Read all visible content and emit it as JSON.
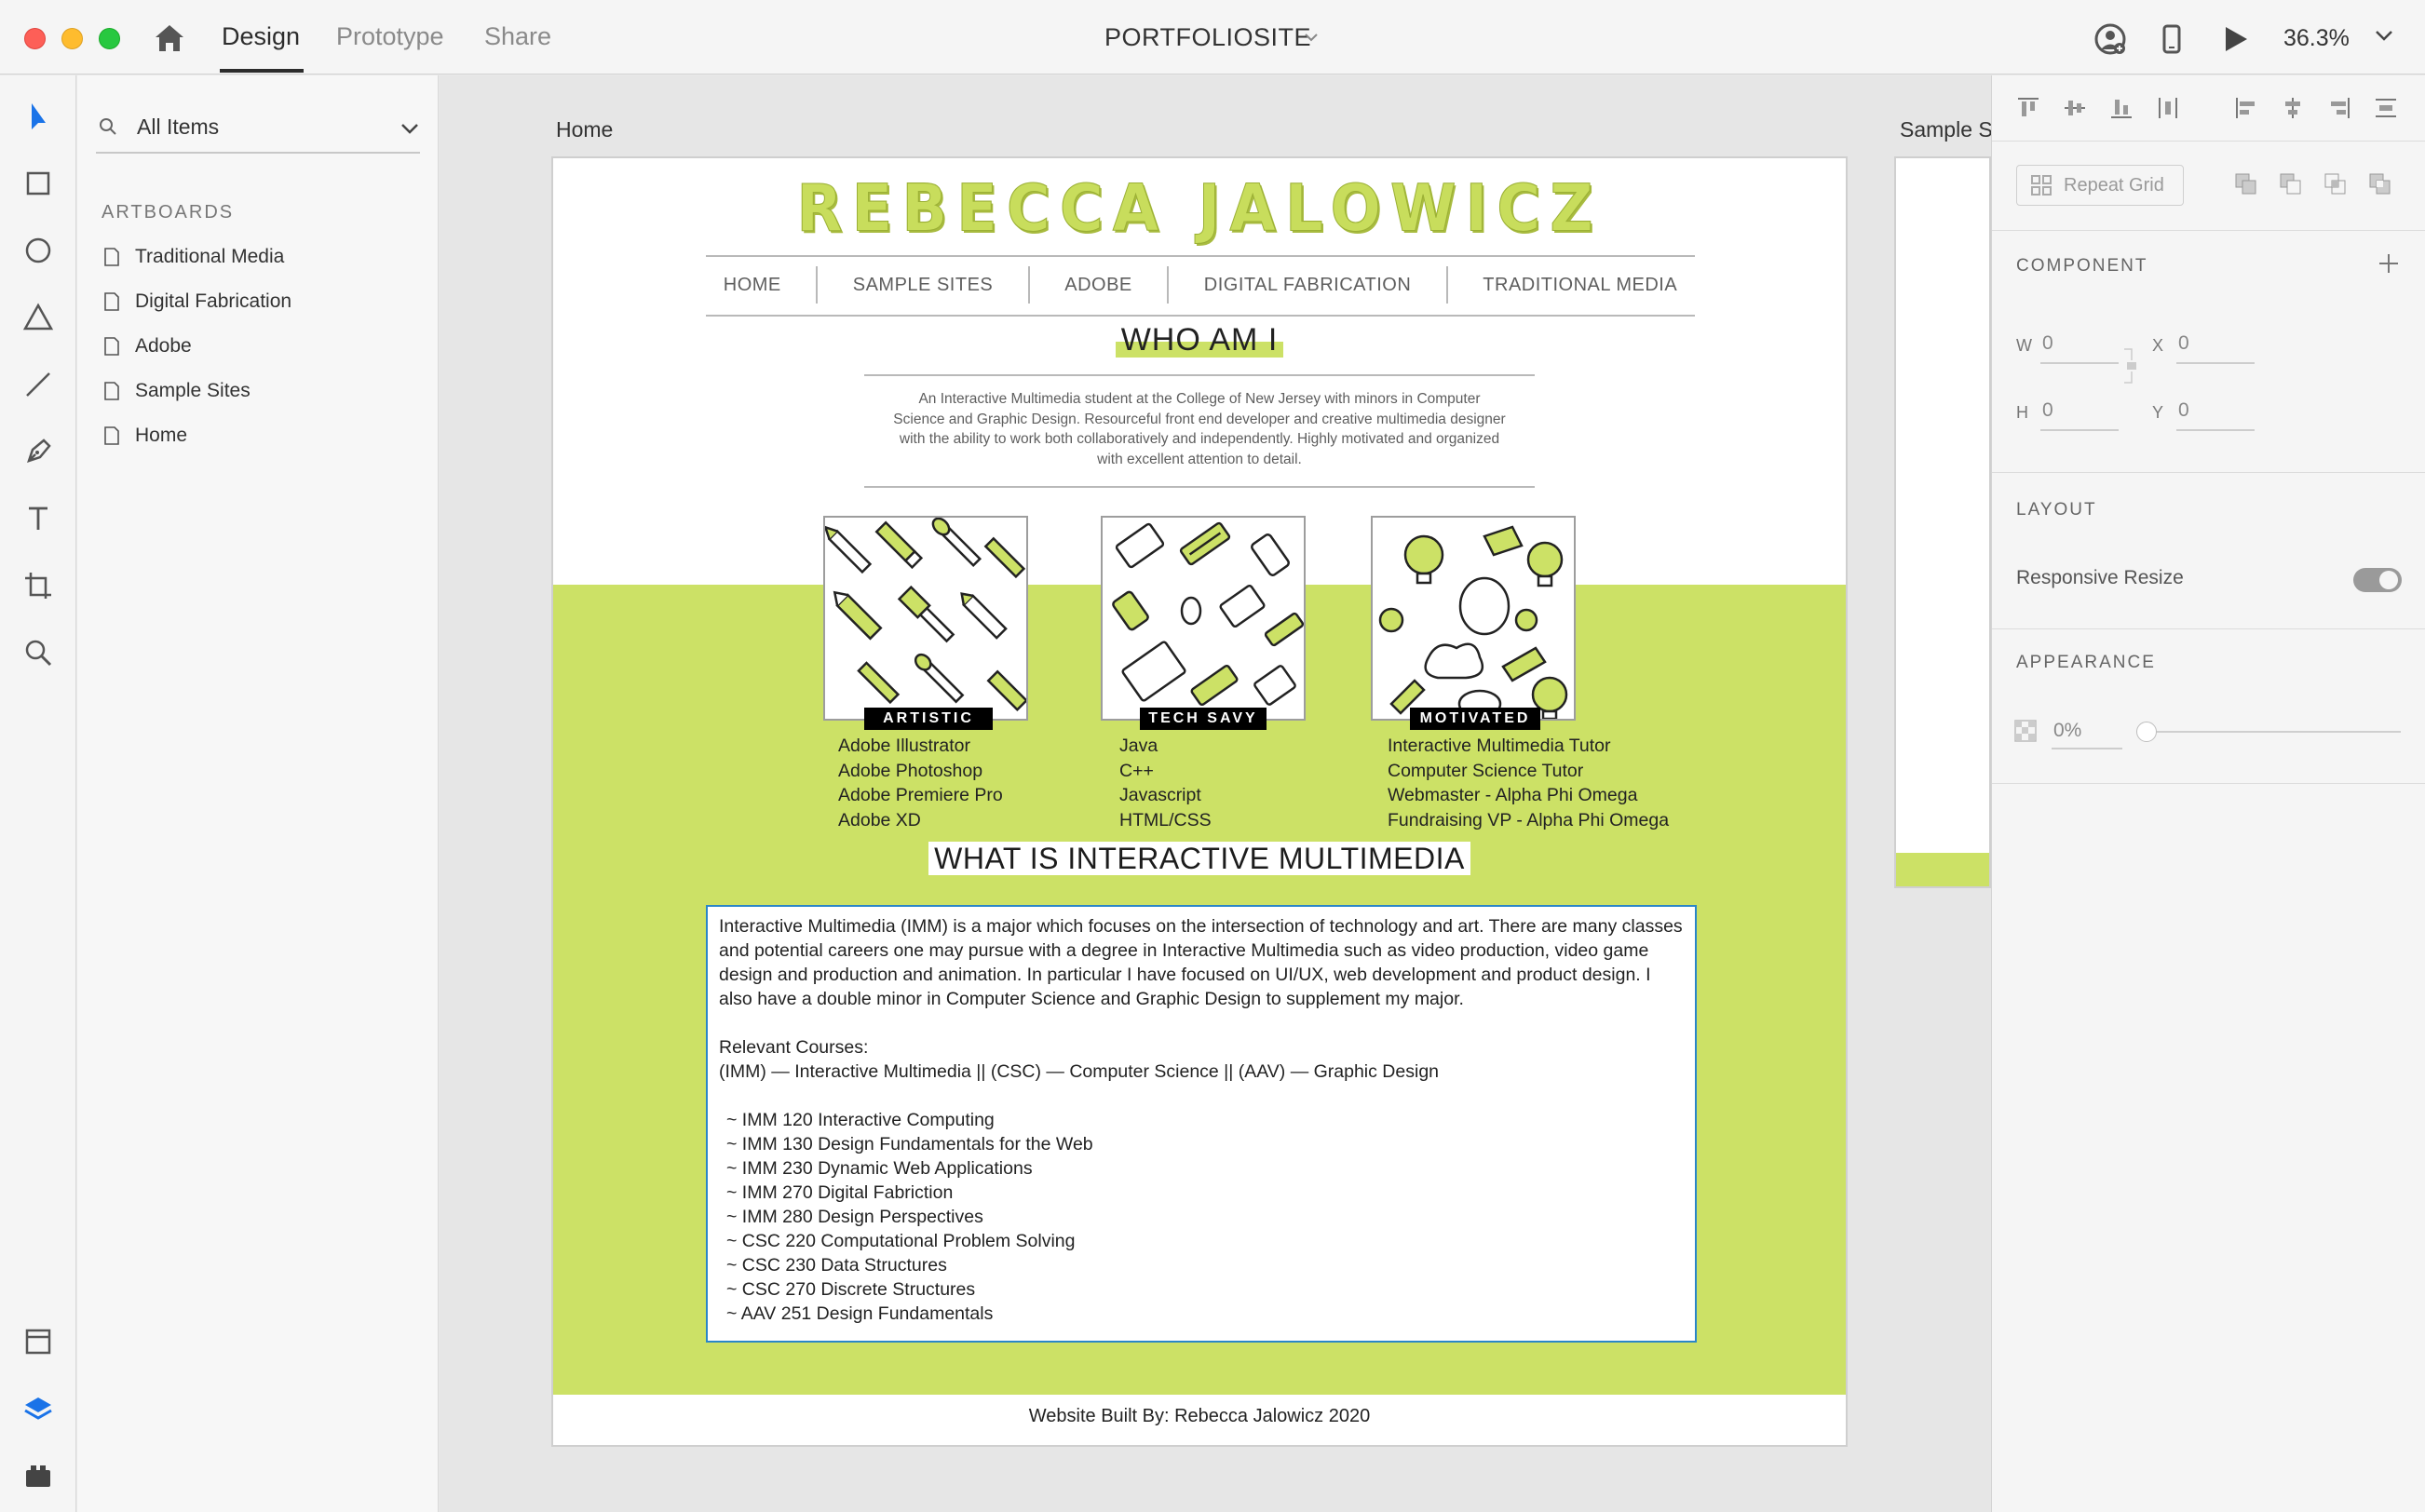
{
  "titlebar": {
    "mode_tabs": [
      "Design",
      "Prototype",
      "Share"
    ],
    "active_tab": "Design",
    "document_title": "PORTFOLIOSITE",
    "zoom": "36.3%"
  },
  "layers_panel": {
    "search_label": "All Items",
    "section_title": "ARTBOARDS",
    "artboards": [
      "Traditional Media",
      "Digital Fabrication",
      "Adobe",
      "Sample Sites",
      "Home"
    ]
  },
  "canvas": {
    "artboard_label": "Home",
    "second_artboard_label": "Sample S"
  },
  "site": {
    "name": "REBECCA JALOWICZ",
    "nav": [
      "HOME",
      "SAMPLE SITES",
      "ADOBE",
      "DIGITAL FABRICATION",
      "TRADITIONAL MEDIA"
    ],
    "who_heading": "WHO AM I",
    "who_text": "An Interactive Multimedia student at the College of New Jersey with minors in Computer Science and Graphic Design. Resourceful front end developer and creative multimedia designer with the ability to work both collaboratively and independently. Highly motivated and organized with excellent attention to detail.",
    "cards": [
      {
        "label": "ARTISTIC",
        "items": [
          "Adobe Illustrator",
          "Adobe Photoshop",
          "Adobe Premiere Pro",
          "Adobe XD"
        ]
      },
      {
        "label": "TECH SAVY",
        "items": [
          "Java",
          "C++",
          "Javascript",
          "HTML/CSS"
        ]
      },
      {
        "label": "MOTIVATED",
        "items": [
          "Interactive Multimedia Tutor",
          "Computer Science Tutor",
          "Webmaster - Alpha Phi Omega",
          "Fundraising VP - Alpha Phi Omega"
        ]
      }
    ],
    "imm_heading": "WHAT IS INTERACTIVE MULTIMEDIA",
    "imm_paragraph": "Interactive Multimedia (IMM) is a major which focuses on the intersection of technology and art. There are many classes and potential careers one may pursue with a degree in Interactive Multimedia such as video production, video game design and production and animation. In particular I have focused on UI/UX, web development and product design. I also have a double minor in Computer Science and Graphic Design to supplement my major.",
    "courses_label": "Relevant Courses:",
    "courses_legend": "(IMM) — Interactive Multimedia || (CSC) — Computer Science || (AAV) — Graphic Design",
    "courses": [
      "~ IMM 120 Interactive Computing",
      "~ IMM 130 Design Fundamentals for the Web",
      "~ IMM 230 Dynamic Web Applications",
      "~ IMM 270 Digital Fabriction",
      "~ IMM 280 Design Perspectives",
      "~ CSC 220 Computational Problem Solving",
      "~ CSC 230 Data Structures",
      "~ CSC 270 Discrete Structures",
      "~ AAV 251 Design Fundamentals"
    ],
    "footer": "Website Built By: Rebecca Jalowicz 2020"
  },
  "properties_panel": {
    "repeat_grid_label": "Repeat Grid",
    "component_heading": "COMPONENT",
    "fields": {
      "w_label": "W",
      "w_value": "0",
      "h_label": "H",
      "h_value": "0",
      "x_label": "X",
      "x_value": "0",
      "y_label": "Y",
      "y_value": "0"
    },
    "layout_heading": "LAYOUT",
    "responsive_resize_label": "Responsive Resize",
    "appearance_heading": "APPEARANCE",
    "opacity_value": "0%"
  },
  "colors": {
    "accent_green": "#cce166",
    "selection_blue": "#2a86c8",
    "toolbar_blue": "#1a73e8"
  }
}
